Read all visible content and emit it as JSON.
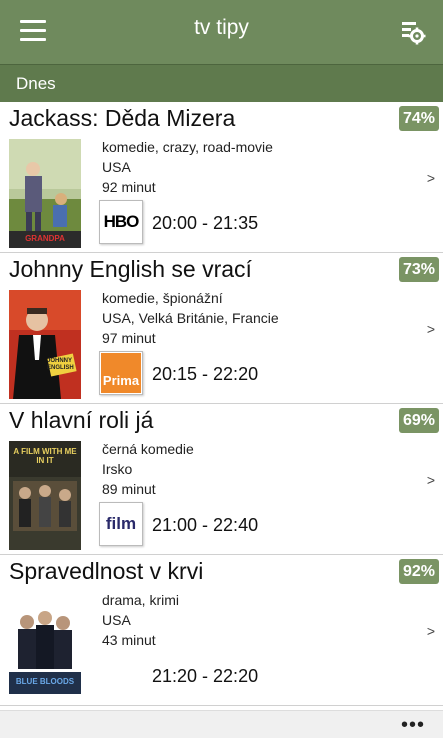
{
  "app": {
    "title": "tv tipy"
  },
  "section": {
    "label": "Dnes"
  },
  "theme": {
    "accent": "#6f8a5d",
    "rating_badge": "#7a9464"
  },
  "items": [
    {
      "title": "Jackass: Děda Mizera",
      "rating": "74%",
      "genres": "komedie, crazy, road-movie",
      "country": "USA",
      "duration": "92 minut",
      "channel_icon": "hbo-logo",
      "time": "20:00 - 21:35"
    },
    {
      "title": "Johnny English se vrací",
      "rating": "73%",
      "genres": "komedie, špionážní",
      "country": "USA, Velká Británie, Francie",
      "duration": "97 minut",
      "channel_icon": "prima-logo",
      "time": "20:15 - 22:20"
    },
    {
      "title": "V hlavní roli já",
      "rating": "69%",
      "genres": "černá komedie",
      "country": "Irsko",
      "duration": "89 minut",
      "channel_icon": "film-logo",
      "time": "21:00 - 22:40"
    },
    {
      "title": "Spravedlnost v krvi",
      "rating": "92%",
      "genres": "drama, krimi",
      "country": "USA",
      "duration": "43 minut",
      "channel_icon": "",
      "time": "21:20 - 22:20"
    }
  ],
  "logos": {
    "hbo": "HBO",
    "prima": "Prima",
    "film": "film"
  },
  "posters": {
    "p1": "GRANDPA",
    "p2": "JOHNNY ENGLISH",
    "p3": "A FILM WITH ME IN IT",
    "p4": "BLUE BLOODS"
  },
  "chevron": ">",
  "bottombar": {
    "more": "•••"
  }
}
